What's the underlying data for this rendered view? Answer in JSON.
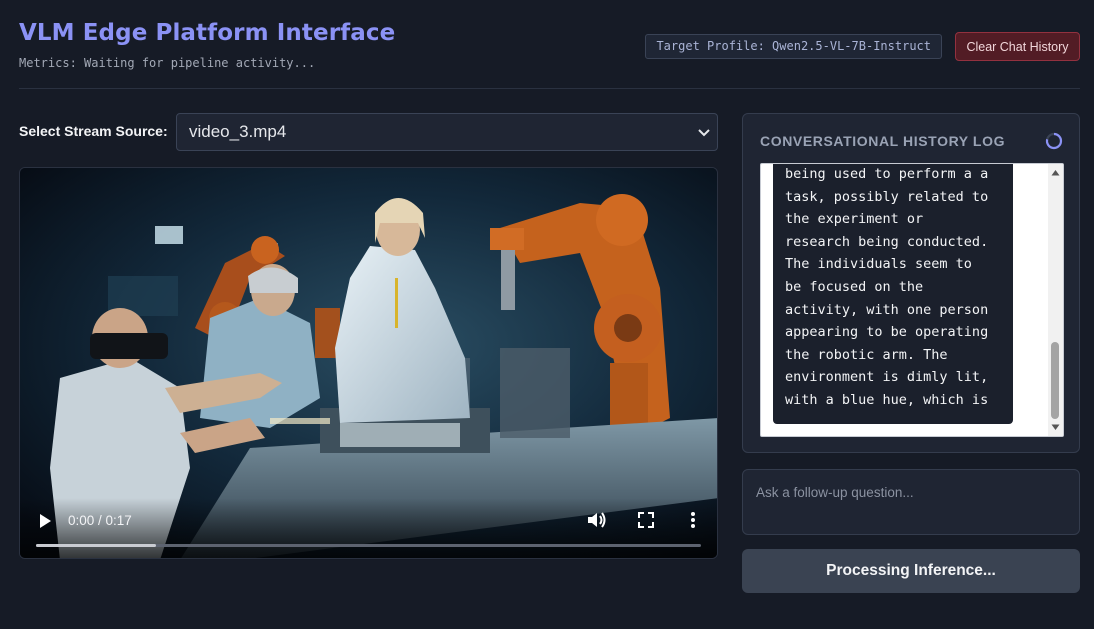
{
  "header": {
    "title": "VLM Edge Platform Interface",
    "metrics": "Metrics: Waiting for pipeline activity...",
    "profile_badge": "Target Profile: Qwen2.5-VL-7B-Instruct",
    "clear_button": "Clear Chat History"
  },
  "source": {
    "label": "Select Stream Source:",
    "selected": "video_3.mp4"
  },
  "video": {
    "time": "0:00 / 0:17",
    "buffered_fraction": 0.18
  },
  "history": {
    "title": "CONVERSATIONAL HISTORY LOG",
    "text": "being used to perform a a\ntask, possibly related to\nthe experiment or\nresearch being conducted.\nThe individuals seem to\nbe focused on the\nactivity, with one person\nappearing to be operating\nthe robotic arm. The\nenvironment is dimly lit,\nwith a blue hue, which is"
  },
  "followup": {
    "placeholder": "Ask a follow-up question..."
  },
  "process_button": "Processing Inference...",
  "icons": {
    "select": "chevron-down-icon",
    "play": "play-icon",
    "volume": "volume-icon",
    "fullscreen": "fullscreen-icon",
    "menu": "more-vertical-icon",
    "spinner": "loading-spinner-icon"
  },
  "colors": {
    "accent": "#8b92f5",
    "danger_bg": "#521c25",
    "danger_border": "#93313f",
    "panel": "#1f2533",
    "background": "#161b26"
  }
}
